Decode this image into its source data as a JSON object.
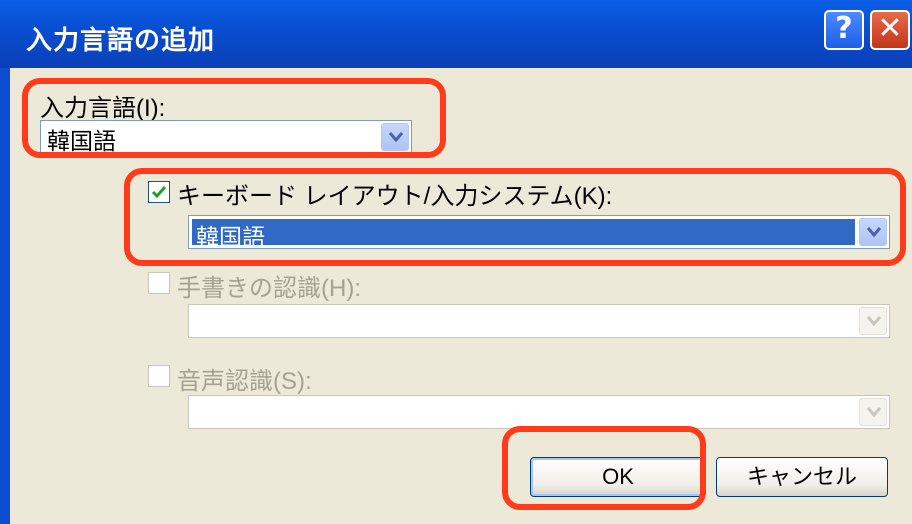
{
  "window": {
    "title": "入力言語の追加",
    "help_glyph": "?",
    "close_glyph": "✕"
  },
  "input_language": {
    "label": "入力言語(I):",
    "value": "韓国語"
  },
  "keyboard_layout": {
    "label": "キーボード レイアウト/入力システム(K):",
    "value": "韓国語",
    "checked": true
  },
  "handwriting": {
    "label": "手書きの認識(H):",
    "value": "",
    "checked": false,
    "enabled": false
  },
  "speech": {
    "label": "音声認識(S):",
    "value": "",
    "checked": false,
    "enabled": false
  },
  "buttons": {
    "ok": "OK",
    "cancel": "キャンセル"
  },
  "colors": {
    "highlight": "#ff3b1a",
    "selection": "#316ac5",
    "titlebar": "#0a4fd1"
  }
}
